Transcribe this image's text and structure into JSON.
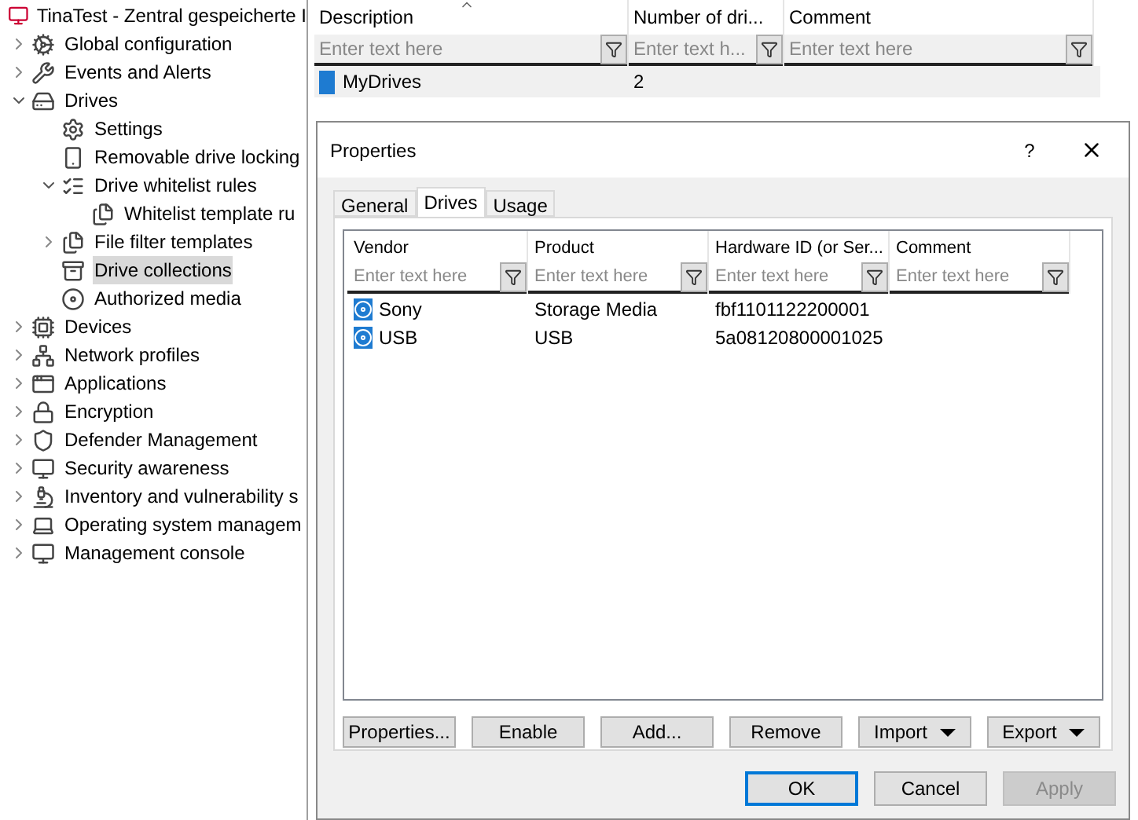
{
  "tree": {
    "root": "TinaTest - Zentral gespeicherte I",
    "items": [
      {
        "label": "Global configuration",
        "expanded": false
      },
      {
        "label": "Events and Alerts",
        "expanded": false
      },
      {
        "label": "Drives",
        "expanded": true,
        "children": [
          {
            "label": "Settings"
          },
          {
            "label": "Removable drive locking"
          },
          {
            "label": "Drive whitelist rules",
            "expanded": true,
            "children": [
              {
                "label": "Whitelist template ru"
              }
            ]
          },
          {
            "label": "File filter templates",
            "expanded": false
          },
          {
            "label": "Drive collections",
            "selected": true
          },
          {
            "label": "Authorized media"
          }
        ]
      },
      {
        "label": "Devices",
        "expanded": false
      },
      {
        "label": "Network profiles",
        "expanded": false
      },
      {
        "label": "Applications",
        "expanded": false
      },
      {
        "label": "Encryption",
        "expanded": false
      },
      {
        "label": "Defender Management",
        "expanded": false
      },
      {
        "label": "Security awareness",
        "expanded": false
      },
      {
        "label": "Inventory and vulnerability s",
        "expanded": false
      },
      {
        "label": "Operating system managem",
        "expanded": false
      },
      {
        "label": "Management console",
        "expanded": false
      }
    ]
  },
  "grid": {
    "columns": [
      {
        "label": "Description",
        "sorted": true,
        "placeholder": "Enter text here"
      },
      {
        "label": "Number of dri...",
        "placeholder": "Enter text h..."
      },
      {
        "label": "Comment",
        "placeholder": "Enter text here"
      }
    ],
    "rows": [
      [
        "MyDrives",
        "2",
        ""
      ]
    ]
  },
  "dialog": {
    "title": "Properties",
    "help": "?",
    "tabs": [
      {
        "label": "General",
        "selected": false
      },
      {
        "label": "Drives",
        "selected": true
      },
      {
        "label": "Usage",
        "selected": false
      }
    ],
    "columns": [
      {
        "label": "Vendor",
        "placeholder": "Enter text here"
      },
      {
        "label": "Product",
        "placeholder": "Enter text here"
      },
      {
        "label": "Hardware ID (or Ser...",
        "placeholder": "Enter text here"
      },
      {
        "label": "Comment",
        "placeholder": "Enter text here"
      }
    ],
    "rows": [
      [
        "Sony",
        "Storage Media",
        "fbf1101122200001",
        ""
      ],
      [
        "USB",
        "USB",
        "5a08120800001025",
        ""
      ]
    ],
    "actions": [
      {
        "label": "Properties..."
      },
      {
        "label": "Enable"
      },
      {
        "label": "Add..."
      },
      {
        "label": "Remove"
      },
      {
        "label": "Import",
        "menu": true
      },
      {
        "label": "Export",
        "menu": true
      }
    ],
    "buttons": [
      {
        "label": "OK",
        "default": true,
        "disabled": false
      },
      {
        "label": "Cancel",
        "default": false,
        "disabled": false
      },
      {
        "label": "Apply",
        "default": false,
        "disabled": true
      }
    ]
  }
}
